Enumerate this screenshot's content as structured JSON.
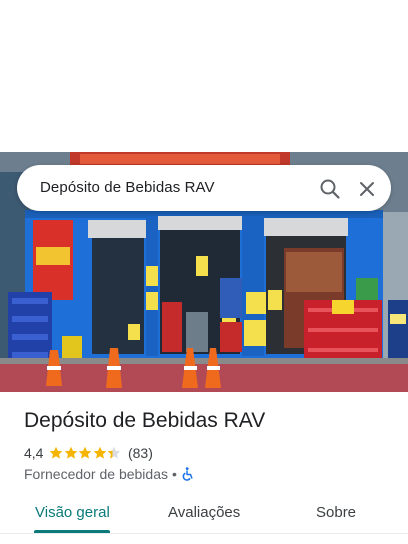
{
  "search": {
    "query": "Depósito de Bebidas RAV",
    "search_icon": "search-icon",
    "close_icon": "close-icon"
  },
  "photo": {
    "description_icon": "storefront-photo"
  },
  "place": {
    "title": "Depósito de Bebidas RAV",
    "rating": "4,4",
    "rating_value": 4.4,
    "stars_max": 5,
    "review_count": "(83)",
    "category": "Fornecedor de bebidas",
    "separator": "•",
    "accessibility_icon": "wheelchair-icon"
  },
  "tabs": [
    {
      "label": "Visão geral",
      "active": true
    },
    {
      "label": "Avaliações",
      "active": false
    },
    {
      "label": "Sobre",
      "active": false
    }
  ],
  "colors": {
    "accent": "#0b7a7a",
    "star": "#f5b400",
    "star_empty": "#dadce0",
    "wheelchair": "#1a73e8"
  }
}
